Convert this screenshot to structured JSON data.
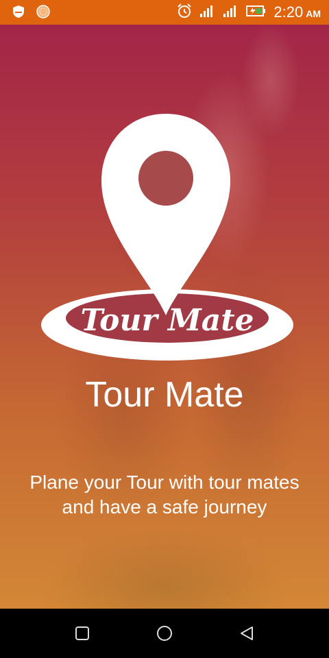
{
  "status_bar": {
    "time": "2:20",
    "ampm": "AM",
    "icons": [
      "shield-icon",
      "sun-icon",
      "alarm-icon",
      "signal-icon",
      "signal-icon",
      "battery-charging-icon"
    ]
  },
  "app": {
    "logo_text": "Tour Mate",
    "title": "Tour Mate",
    "tagline": "Plane your Tour with tour mates and have a safe journey"
  },
  "colors": {
    "status_bar": "#e0640e",
    "gradient_top": "#b0284e",
    "gradient_bottom": "#eb963c",
    "text": "#ffffff"
  },
  "nav_bar": {
    "buttons": [
      "square-icon",
      "circle-icon",
      "triangle-back-icon"
    ]
  }
}
